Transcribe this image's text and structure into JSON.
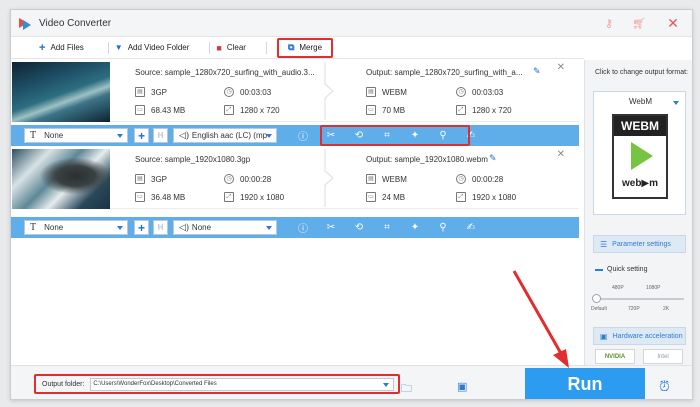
{
  "window": {
    "title": "Video Converter"
  },
  "titlebar": {
    "icons": [
      "key-icon",
      "cart-icon",
      "close-icon"
    ]
  },
  "toolbar": {
    "add_files": "Add Files",
    "add_video_folder": "Add Video Folder",
    "clear": "Clear",
    "merge": "Merge"
  },
  "files": [
    {
      "source": "Source: sample_1280x720_surfing_with_audio.3...",
      "output": "Output: sample_1280x720_surfing_with_a...",
      "src_format": "3GP",
      "src_duration": "00:03:03",
      "src_size": "68.43 MB",
      "src_resolution": "1280 x 720",
      "out_format": "WEBM",
      "out_duration": "00:03:03",
      "out_size": "70 MB",
      "out_resolution": "1280 x 720",
      "subtitle": "None",
      "audio": "English aac (LC) (mp"
    },
    {
      "source": "Source: sample_1920x1080.3gp",
      "output": "Output: sample_1920x1080.webm",
      "src_format": "3GP",
      "src_duration": "00:00:28",
      "src_size": "36.48 MB",
      "src_resolution": "1920 x 1080",
      "out_format": "WEBM",
      "out_duration": "00:00:28",
      "out_size": "24 MB",
      "out_resolution": "1920 x 1080",
      "subtitle": "None",
      "audio": "None"
    }
  ],
  "right_panel": {
    "title": "Click to change output format:",
    "format": "WebM",
    "format_icon_top": "WEBM",
    "format_icon_bottom": "web▶m",
    "parameter_settings": "Parameter settings",
    "quick_setting": "Quick setting",
    "quality_top": [
      "480P",
      "1080P"
    ],
    "quality_bottom": [
      "Default",
      "720P",
      "2K"
    ],
    "hardware_acceleration": "Hardware acceleration",
    "gpu_nvidia": "NVIDIA",
    "gpu_intel": "Intel"
  },
  "bottom": {
    "output_folder_label": "Output folder:",
    "output_folder_path": "C:\\Users\\WonderFox\\Desktop\\Converted Files",
    "run": "Run"
  },
  "colors": {
    "accent": "#2b9cf0",
    "edit_bar": "#5faeea",
    "highlight": "#e12d2d"
  }
}
